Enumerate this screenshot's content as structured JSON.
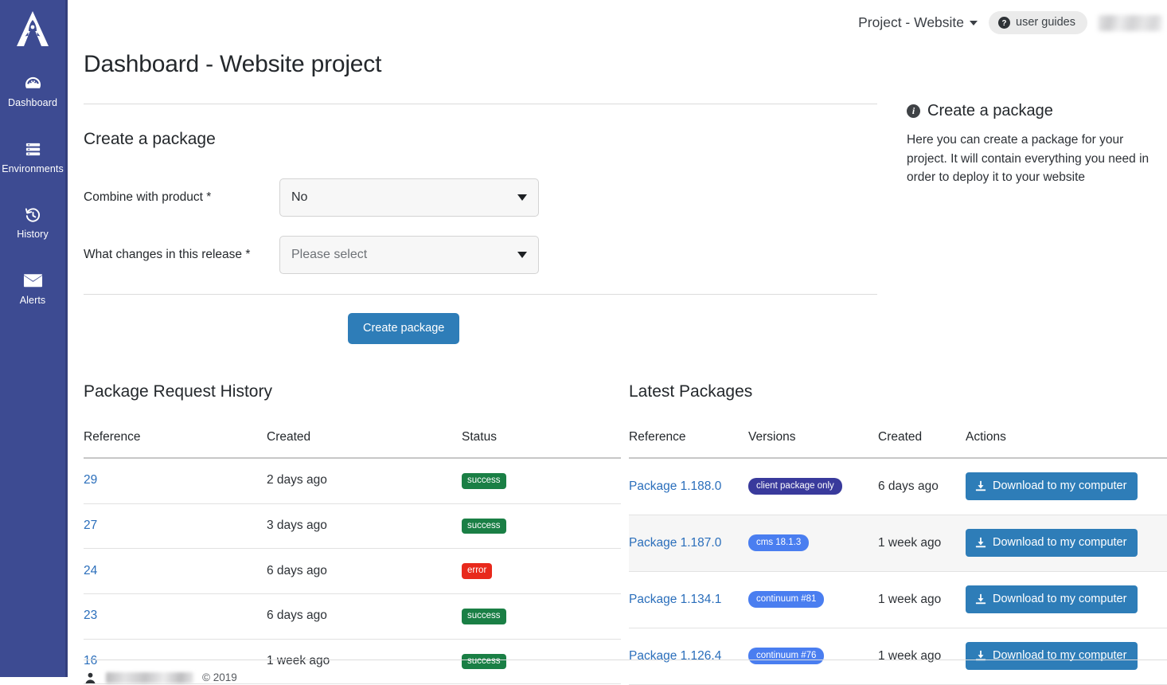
{
  "sidebar": {
    "logo_name": "rocket-a-logo",
    "items": [
      {
        "label": "Dashboard",
        "icon": "dashboard-gauge-icon"
      },
      {
        "label": "Environments",
        "icon": "server-stack-icon"
      },
      {
        "label": "History",
        "icon": "history-clock-icon"
      },
      {
        "label": "Alerts",
        "icon": "envelope-icon"
      }
    ]
  },
  "topbar": {
    "project_switcher": "Project - Website",
    "user_guides": "user guides",
    "user_name_redacted": ""
  },
  "page": {
    "title": "Dashboard - Website project"
  },
  "create_package": {
    "section_title": "Create a package",
    "fields": [
      {
        "label": "Combine with product *",
        "value": "No",
        "is_placeholder": false
      },
      {
        "label": "What changes in this release *",
        "value": "Please select",
        "is_placeholder": true
      }
    ],
    "submit_label": "Create package"
  },
  "info_panel": {
    "title": "Create a package",
    "body": "Here you can create a package for your project. It will contain everything you need in order to deploy it to your website"
  },
  "package_request_history": {
    "title": "Package Request History",
    "columns": [
      "Reference",
      "Created",
      "Status"
    ],
    "rows": [
      {
        "reference": "29",
        "created": "2 days ago",
        "status": "success",
        "status_type": "success"
      },
      {
        "reference": "27",
        "created": "3 days ago",
        "status": "success",
        "status_type": "success"
      },
      {
        "reference": "24",
        "created": "6 days ago",
        "status": "error",
        "status_type": "error"
      },
      {
        "reference": "23",
        "created": "6 days ago",
        "status": "success",
        "status_type": "success"
      },
      {
        "reference": "16",
        "created": "1 week ago",
        "status": "success",
        "status_type": "success"
      }
    ]
  },
  "latest_packages": {
    "title": "Latest Packages",
    "columns": [
      "Reference",
      "Versions",
      "Created",
      "Actions"
    ],
    "action_label": "Download to my computer",
    "rows": [
      {
        "reference": "Package 1.188.0",
        "version": "client package only",
        "version_style": "dark",
        "created": "6 days ago"
      },
      {
        "reference": "Package 1.187.0",
        "version": "cms 18.1.3",
        "version_style": "light",
        "created": "1 week ago"
      },
      {
        "reference": "Package 1.134.1",
        "version": "continuum #81",
        "version_style": "light",
        "created": "1 week ago"
      },
      {
        "reference": "Package 1.126.4",
        "version": "continuum #76",
        "version_style": "light",
        "created": "1 week ago"
      }
    ]
  },
  "footer": {
    "copyright": "© 2019"
  },
  "colors": {
    "sidebar": "#3d4b92",
    "primary_button": "#2e7db8",
    "success": "#1a7f45",
    "error": "#e8291c",
    "version_badge": "#4a7ef0",
    "version_badge_dark": "#393a9c",
    "link": "#2a6ebb"
  }
}
